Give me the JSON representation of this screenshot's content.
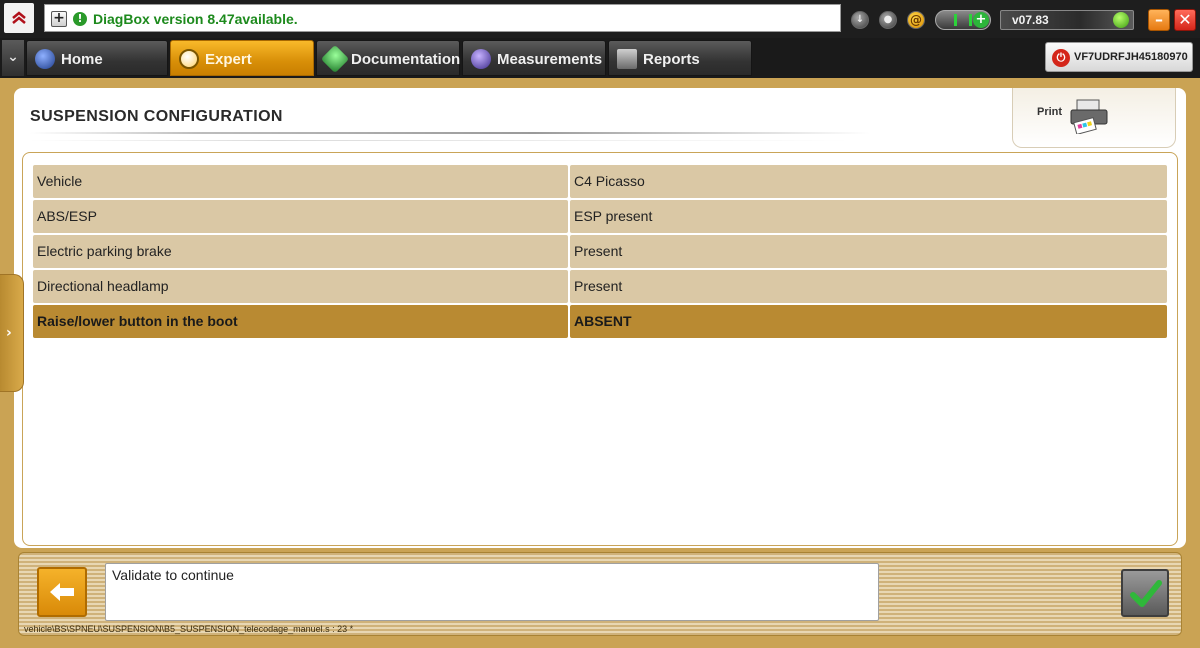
{
  "titlebar": {
    "message": "DiagBox version 8.47available.",
    "version": "v07.83"
  },
  "tabs": [
    {
      "label": "Home",
      "active": false
    },
    {
      "label": "Expert",
      "active": true
    },
    {
      "label": "Documentation",
      "active": false
    },
    {
      "label": "Measurements",
      "active": false
    },
    {
      "label": "Reports",
      "active": false
    }
  ],
  "vin": "VF7UDRFJH45180970",
  "panel": {
    "title": "SUSPENSION  CONFIGURATION",
    "print_label": "Print",
    "rows": [
      {
        "key": "Vehicle",
        "value": "C4 Picasso",
        "selected": false
      },
      {
        "key": "ABS/ESP",
        "value": "ESP present",
        "selected": false
      },
      {
        "key": "Electric parking brake",
        "value": "Present",
        "selected": false
      },
      {
        "key": "Directional headlamp",
        "value": "Present",
        "selected": false
      },
      {
        "key": "Raise/lower button in the boot",
        "value": "ABSENT",
        "selected": true
      }
    ]
  },
  "footer": {
    "message": "Validate to continue",
    "path": "vehicle\\BS\\SPNEU\\SUSPENSION\\B5_SUSPENSION_telecodage_manuel.s : 23 *"
  },
  "colors": {
    "accent": "#d88f08",
    "frame": "#caa354",
    "row_bg": "#dac8a5",
    "row_selected": "#b98a32",
    "message_green": "#1d8a1d"
  },
  "icons": [
    "citroen-logo-icon",
    "plus-icon",
    "info-icon",
    "download-icon",
    "user-icon",
    "at-icon",
    "connection-toggle-icon",
    "usb-icon",
    "minimize-icon",
    "close-icon",
    "menu-chevron-icon",
    "home-icon",
    "magnifier-icon",
    "book-icon",
    "waveform-icon",
    "report-icon",
    "power-icon",
    "printer-icon",
    "side-expand-icon",
    "back-arrow-icon",
    "checkmark-icon"
  ]
}
